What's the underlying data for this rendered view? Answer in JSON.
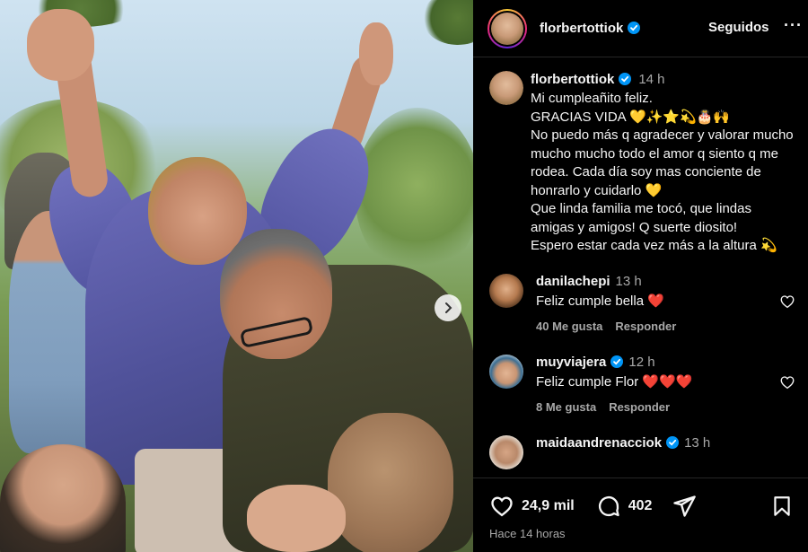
{
  "post": {
    "username": "florbertottiok",
    "follow_status": "Seguidos",
    "more_label": "···"
  },
  "caption": {
    "username": "florbertottiok",
    "time": "14 h",
    "text": "Mi cumpleañito feliz.\nGRACIAS VIDA 💛✨⭐💫🎂🙌\nNo puedo más q agradecer y valorar mucho mucho mucho todo el amor q siento q me rodea. Cada día soy mas conciente de honrarlo y cuidarlo 💛\nQue linda familia me tocó, que lindas amigas y amigos! Q suerte diosito!\nEspero estar cada vez más a la altura 💫"
  },
  "comments": [
    {
      "username": "danilachepi",
      "time": "13 h",
      "text": "Feliz cumple bella ❤️",
      "likes": "40 Me gusta",
      "reply": "Responder"
    },
    {
      "username": "muyviajera",
      "verified": true,
      "time": "12 h",
      "text": "Feliz cumple Flor ❤️❤️❤️",
      "likes": "8 Me gusta",
      "reply": "Responder"
    },
    {
      "username": "maidaandrenacciok",
      "verified": true,
      "time": "13 h"
    }
  ],
  "footer": {
    "likes_count": "24,9 mil",
    "comments_count": "402",
    "posted": "Hace 14 horas"
  },
  "colors": {
    "verified": "#0095f6",
    "heart": "#ff3040",
    "muted": "#a8a8a8"
  }
}
